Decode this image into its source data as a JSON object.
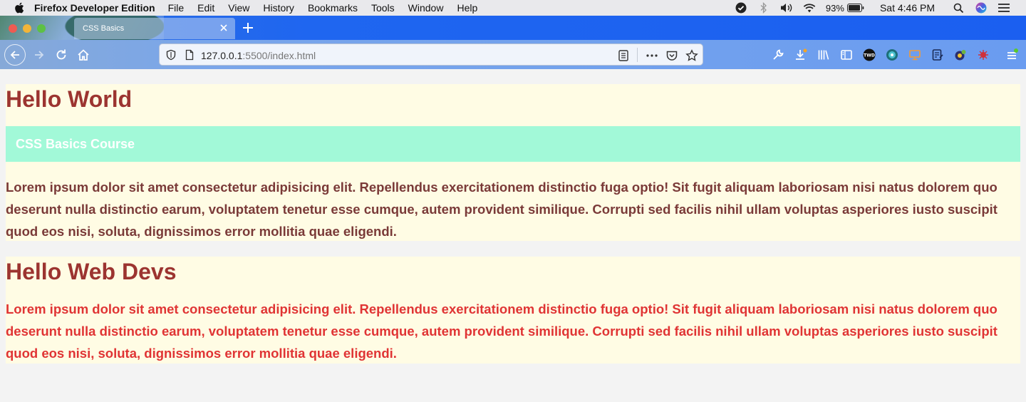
{
  "menubar": {
    "app_name": "Firefox Developer Edition",
    "menus": [
      "File",
      "Edit",
      "View",
      "History",
      "Bookmarks",
      "Tools",
      "Window",
      "Help"
    ],
    "battery": "93%",
    "clock": "Sat 4:46 PM"
  },
  "tabs": [
    {
      "title": "CSS Basics"
    }
  ],
  "navbar": {
    "url_host": "127.0.0.1",
    "url_rest": ":5500/index.html"
  },
  "page": {
    "section1": {
      "heading": "Hello World",
      "subheading": "CSS Basics Course",
      "paragraph": "Lorem ipsum dolor sit amet consectetur adipisicing elit. Repellendus exercitationem distinctio fuga optio! Sit fugit aliquam laboriosam nisi natus dolorem quo deserunt nulla distinctio earum, voluptatem tenetur esse cumque, autem provident similique. Corrupti sed facilis nihil ullam voluptas asperiores iusto suscipit quod eos nisi, soluta, dignissimos error mollitia quae eligendi."
    },
    "section2": {
      "heading": "Hello Web Devs",
      "paragraph": "Lorem ipsum dolor sit amet consectetur adipisicing elit. Repellendus exercitationem distinctio fuga optio! Sit fugit aliquam laboriosam nisi natus dolorem quo deserunt nulla distinctio earum, voluptatem tenetur esse cumque, autem provident similique. Corrupti sed facilis nihil ullam voluptas asperiores iusto suscipit quod eos nisi, soluta, dignissimos error mollitia quae eligendi."
    }
  },
  "colors": {
    "heading": "#9c3430",
    "paragraph1": "#7a3a38",
    "paragraph2": "#e03434",
    "block_bg": "#fffce4",
    "subheading_bg": "#a2f9d8"
  },
  "icons": [
    "apple-icon",
    "shield-check-icon",
    "bluetooth-icon",
    "volume-icon",
    "wifi-icon",
    "battery-icon",
    "spotlight-icon",
    "siri-icon",
    "control-center-icon",
    "back-icon",
    "forward-icon",
    "reload-icon",
    "home-icon",
    "tracking-shield-icon",
    "page-icon",
    "reader-view-icon",
    "more-icon",
    "pocket-icon",
    "bookmark-star-icon",
    "wrench-icon",
    "download-icon",
    "library-icon",
    "sidebar-icon",
    "extension-twd-icon",
    "extension-globe-icon",
    "extension-screen-icon",
    "extension-notes-icon",
    "extension-toggle-icon",
    "extension-bug-icon",
    "menu-icon"
  ]
}
